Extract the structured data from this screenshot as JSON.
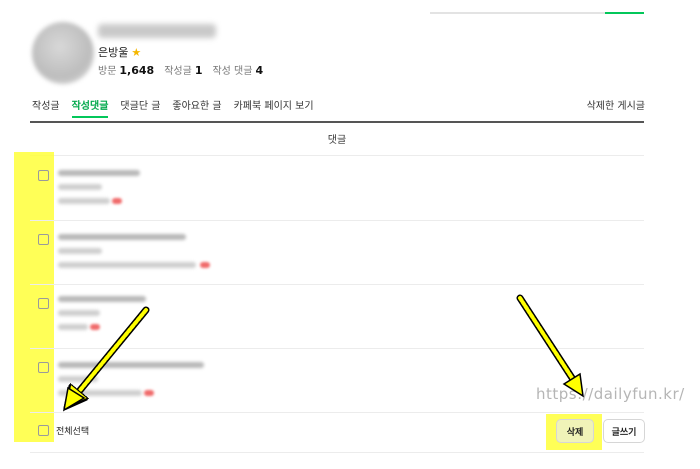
{
  "profile": {
    "nickname": "은방울",
    "star": "★",
    "visits_label": "방문",
    "visits": "1,648",
    "posts_label": "작성글",
    "posts": "1",
    "comments_label": "작성 댓글",
    "comments": "4"
  },
  "tabs": [
    {
      "label": "작성글",
      "active": false
    },
    {
      "label": "작성댓글",
      "active": true
    },
    {
      "label": "댓글단 글",
      "active": false
    },
    {
      "label": "좋아요한 글",
      "active": false
    },
    {
      "label": "카페북 페이지 보기",
      "active": false
    }
  ],
  "deleted_posts_label": "삭제한 게시글",
  "list_header": "댓글",
  "footer": {
    "select_all_label": "전체선택",
    "delete_label": "삭제",
    "write_label": "글쓰기"
  },
  "watermark": "https://dailyfun.kr/",
  "colors": {
    "accent": "#03c75a",
    "highlight": "#ffff3a",
    "arrow": "#ffff00"
  }
}
